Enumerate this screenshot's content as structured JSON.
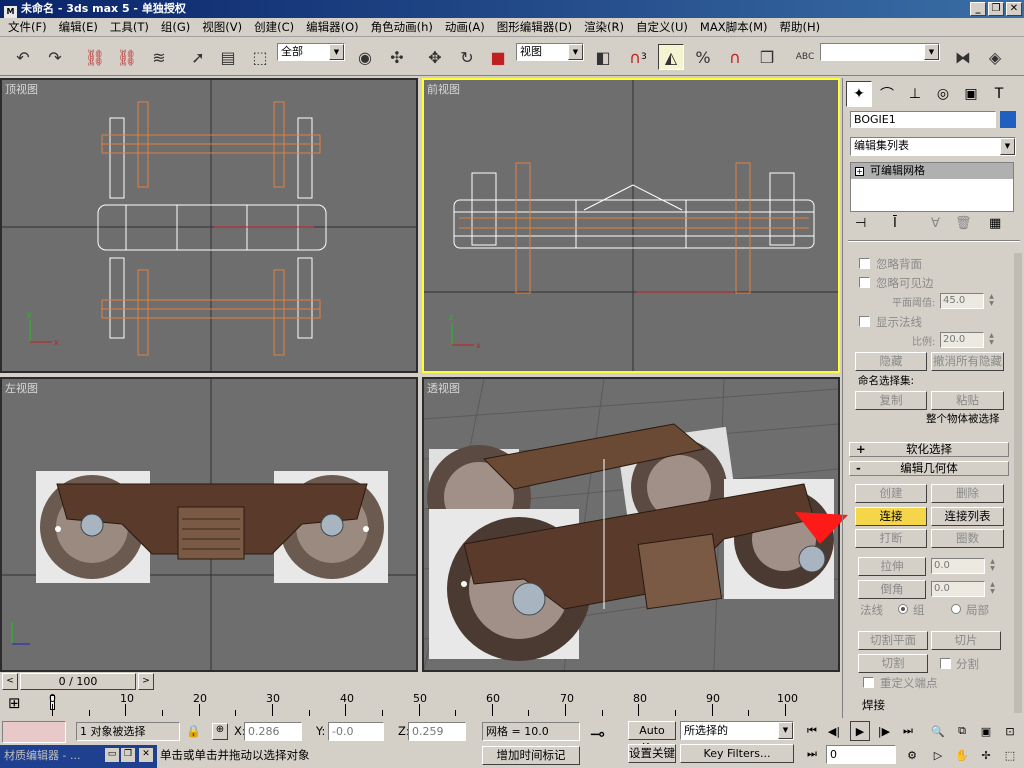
{
  "window": {
    "title": "未命名 - 3ds max 5 - 单独授权",
    "icon": "max-app-icon",
    "controls": [
      "_",
      "❐",
      "✕"
    ]
  },
  "menu": [
    "文件(F)",
    "编辑(E)",
    "工具(T)",
    "组(G)",
    "视图(V)",
    "创建(C)",
    "编辑器(O)",
    "角色动画(h)",
    "动画(A)",
    "图形编辑器(D)",
    "渲染(R)",
    "自定义(U)",
    "MAX脚本(M)",
    "帮助(H)"
  ],
  "toolbar": {
    "selection_filter": "全部",
    "ref_coord": "视图",
    "named_selection": "",
    "snap_label": "3",
    "abc_label": "ABC"
  },
  "viewports": {
    "top": "顶视图",
    "front": "前视图",
    "left": "左视图",
    "perspective": "透视图"
  },
  "command_panel": {
    "object_name": "BOGIE1",
    "object_color": "#1f5fc0",
    "modifier_list": "编辑集列表",
    "stack_item": "可编辑网格",
    "stack_item_sign": "+",
    "selection": {
      "ignore_backfacing": "忽略背面",
      "ignore_visible_edges": "忽略可见边",
      "planar_thresh_label": "平面阈值:",
      "planar_thresh_value": "45.0",
      "show_normals": "显示法线",
      "scale_label": "比例:",
      "scale_value": "20.0",
      "hide": "隐藏",
      "unhide_all": "撤消所有隐藏",
      "named_sel_sets": "命名选择集:",
      "copy": "复制",
      "paste": "粘贴",
      "whole_object": "整个物体被选择"
    },
    "soft_selection": {
      "sign": "+",
      "title": "软化选择"
    },
    "edit_geometry": {
      "sign": "-",
      "title": "编辑几何体",
      "create": "创建",
      "delete": "删除",
      "attach": "连接",
      "attach_list": "连接列表",
      "break": "打断",
      "turn": "圈数",
      "extrude": "拉伸",
      "extrude_value": "0.0",
      "chamfer": "倒角",
      "chamfer_value": "0.0",
      "normal_label": "法线",
      "normal_group": "组",
      "normal_local": "局部",
      "slice_plane": "切割平面",
      "slice": "切片",
      "cut": "切割",
      "split": "分割",
      "refine_ends": "重定义端点"
    },
    "weld_partial": "焊接"
  },
  "timeline": {
    "frame": "0 / 100",
    "ruler_labels": [
      "0",
      "10",
      "20",
      "30",
      "40",
      "50",
      "60",
      "70",
      "80",
      "90",
      "100"
    ]
  },
  "status": {
    "selected": "1 对象被选择",
    "x_label": "X:",
    "x": "0.286",
    "y_label": "Y:",
    "y": "-0.0",
    "z_label": "Z:",
    "z": "0.259",
    "grid": "网格 = 10.0",
    "prompt": "单击或单击并拖动以选择对象",
    "add_time_tag": "增加时间标记",
    "auto_key": "Auto Key",
    "set_key": "设置关键帧",
    "key_mode": "所选择的",
    "key_filters": "Key Filters...",
    "frame_field": "0",
    "taskbar_item": "材质编辑器 - ..."
  },
  "colors": {
    "viewport_bg": "#6e6e6e",
    "active_border": "#ffff30",
    "wheel_white": "#ffffff",
    "axle_orange": "#e08040",
    "highlight_button": "#f5d64a"
  }
}
